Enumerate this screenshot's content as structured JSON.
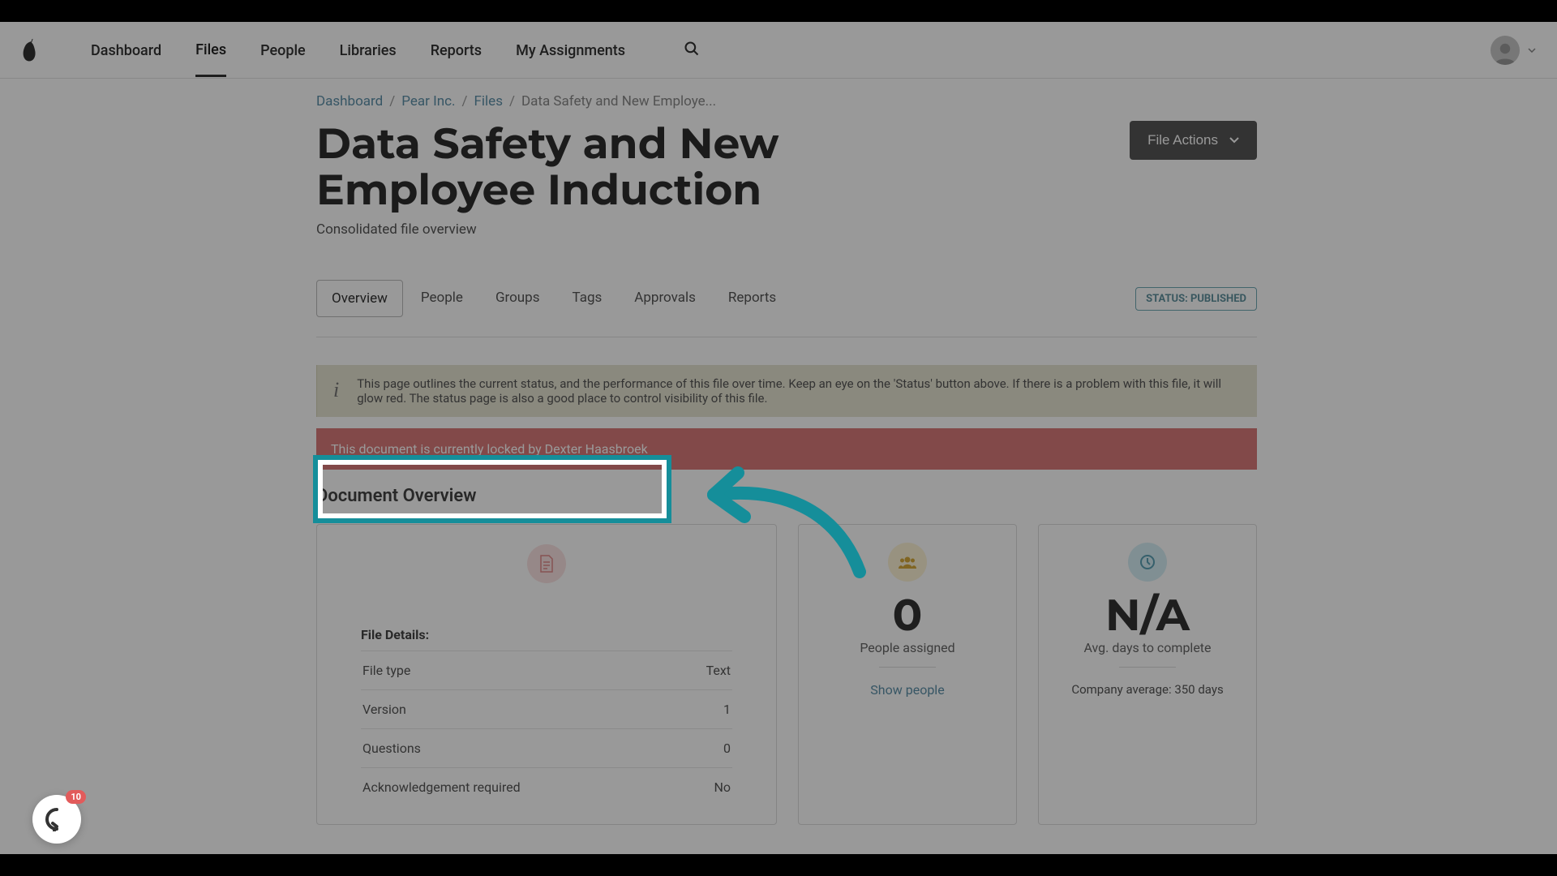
{
  "nav": {
    "items": [
      "Dashboard",
      "Files",
      "People",
      "Libraries",
      "Reports",
      "My Assignments"
    ],
    "active": "Files"
  },
  "breadcrumb": {
    "items": [
      "Dashboard",
      "Pear Inc.",
      "Files"
    ],
    "current": "Data Safety and New Employe..."
  },
  "page": {
    "title": "Data Safety and New Employee Induction",
    "subtitle": "Consolidated file overview",
    "file_actions_label": "File Actions"
  },
  "tabs": {
    "items": [
      "Overview",
      "People",
      "Groups",
      "Tags",
      "Approvals",
      "Reports"
    ],
    "active": "Overview"
  },
  "status_badge": "STATUS: PUBLISHED",
  "info_box": "This page outlines the current status, and the performance of this file over time. Keep an eye on the 'Status' button above. If there is a problem with this file, it will glow red. The status page is also a good place to control visibility of this file.",
  "lock_message": "This document is currently locked by Dexter Haasbroek",
  "section_overview_title": "Document Overview",
  "file_details": {
    "heading": "File Details:",
    "rows": [
      {
        "label": "File type",
        "value": "Text"
      },
      {
        "label": "Version",
        "value": "1"
      },
      {
        "label": "Questions",
        "value": "0"
      },
      {
        "label": "Acknowledgement required",
        "value": "No"
      }
    ]
  },
  "people_card": {
    "number": "0",
    "label": "People assigned",
    "link": "Show people"
  },
  "avg_card": {
    "number": "N/A",
    "label": "Avg. days to complete",
    "sub": "Company average:  350 days"
  },
  "fab_badge": "10",
  "colors": {
    "accent": "#158e9a",
    "danger": "#d97b7b",
    "link": "#5c8fa8"
  }
}
